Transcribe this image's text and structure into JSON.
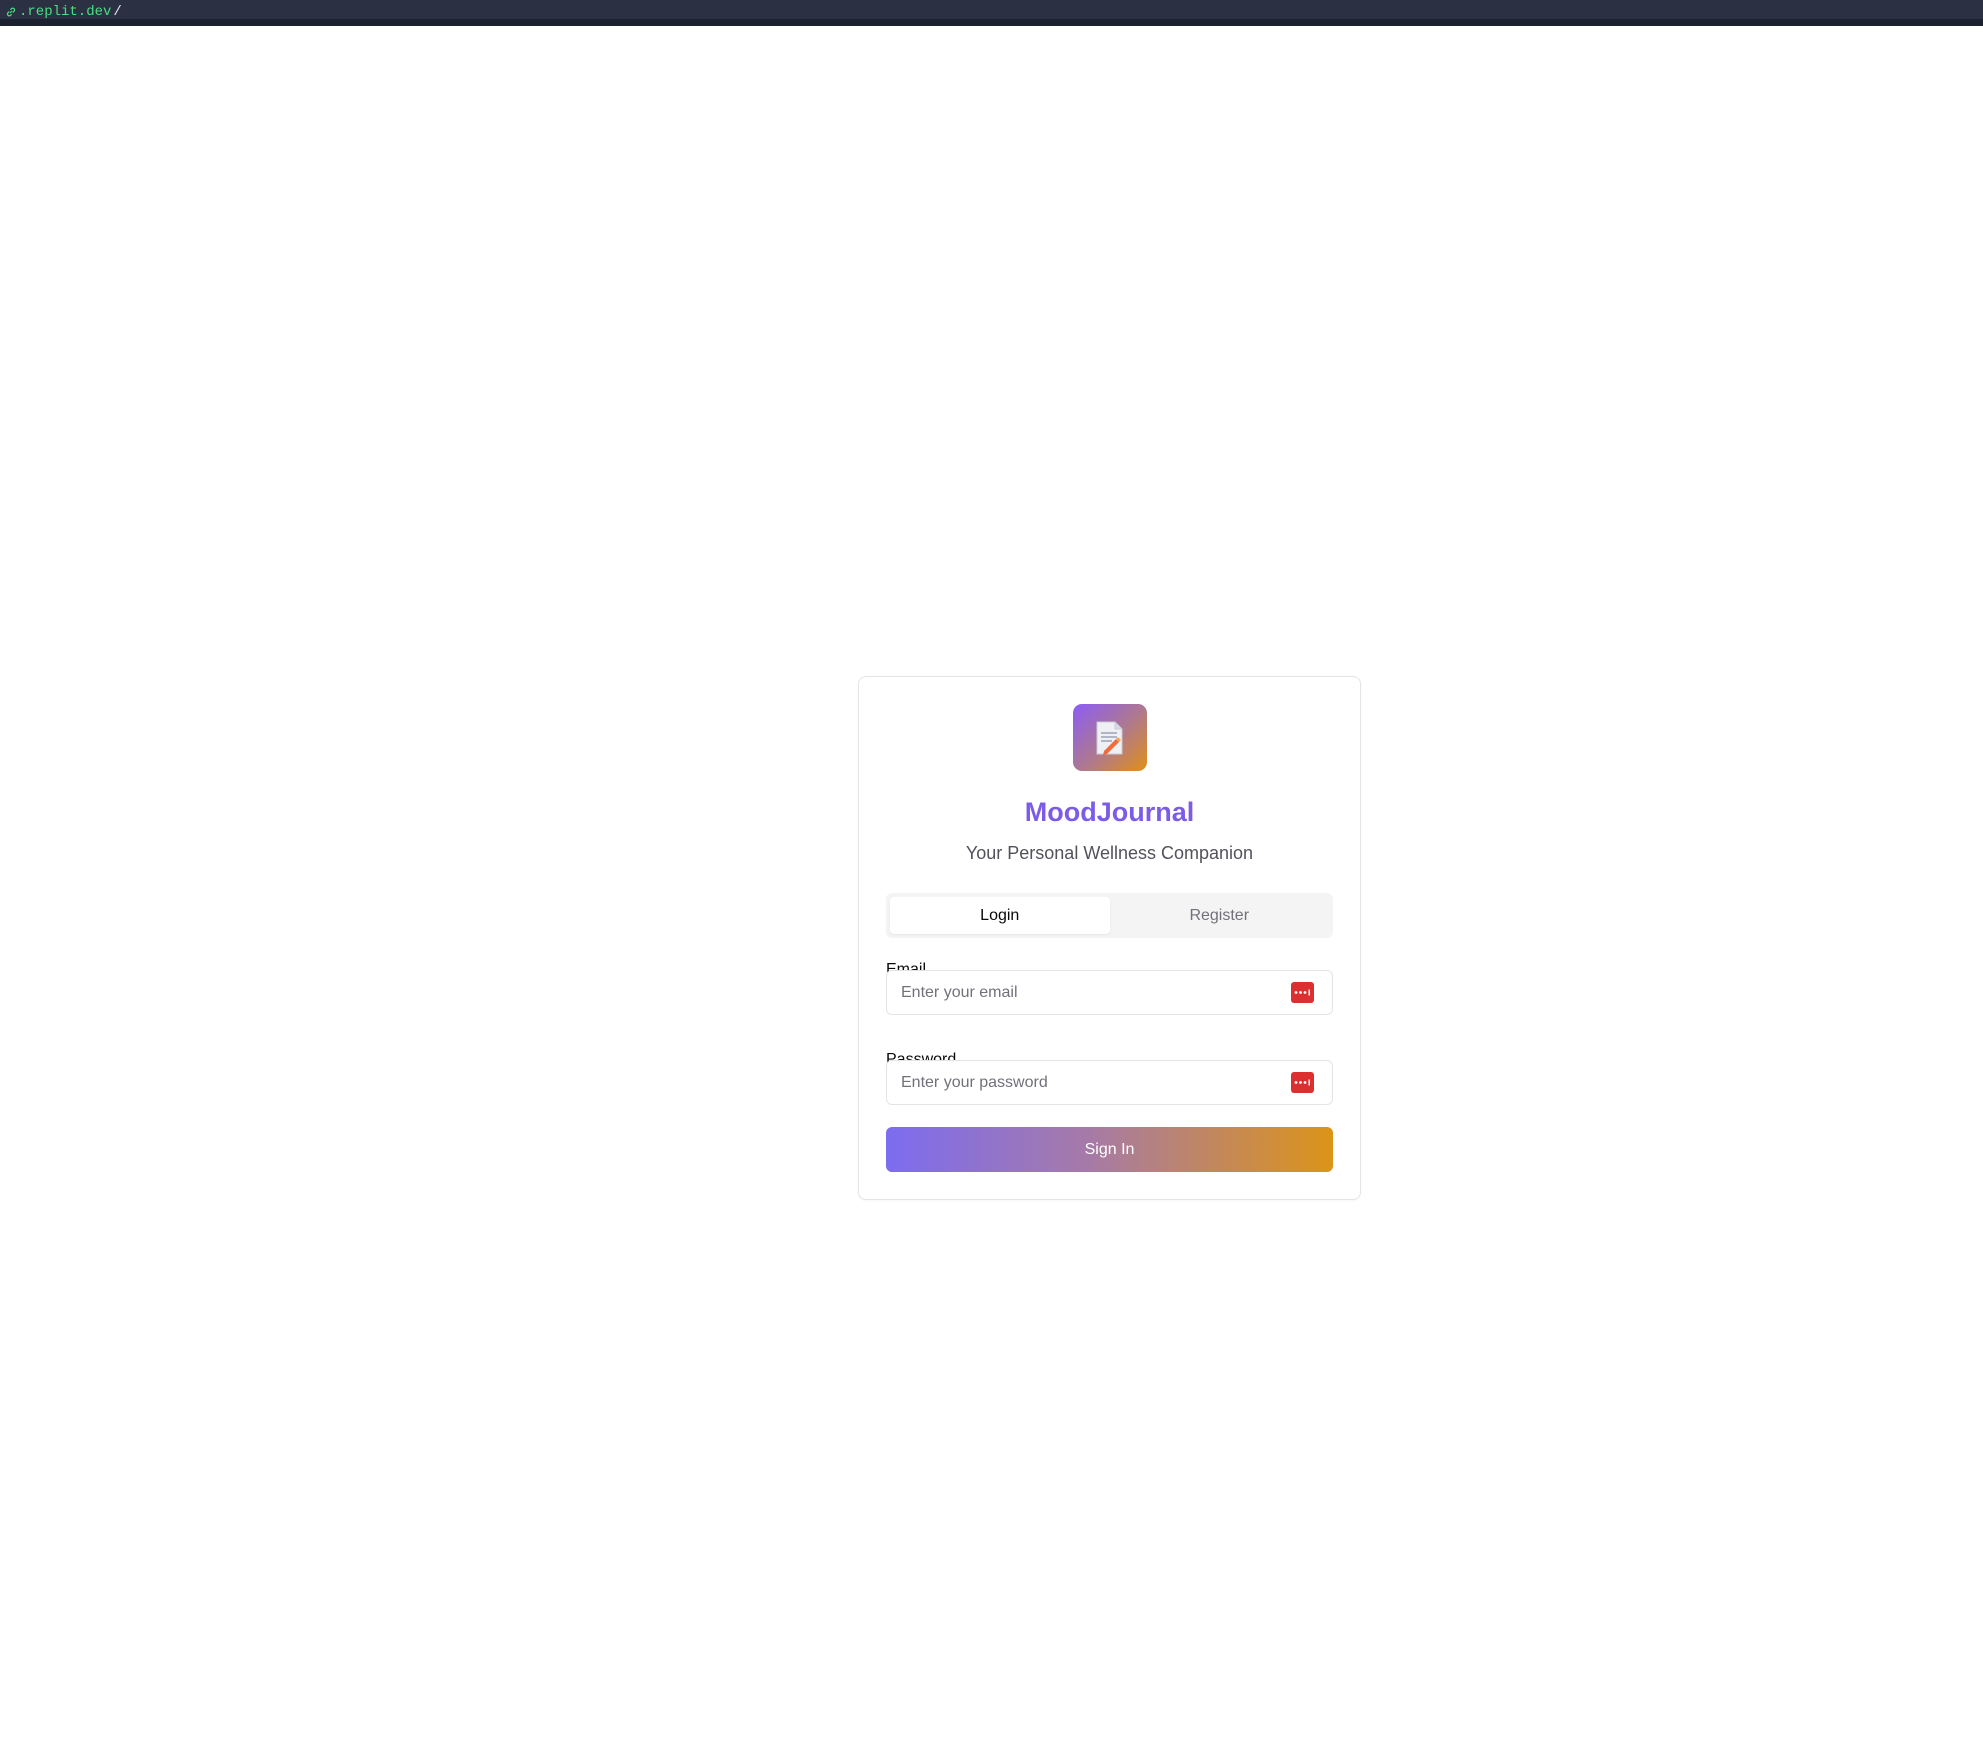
{
  "browser": {
    "url_host": ".replit.dev",
    "url_path": "/"
  },
  "app": {
    "title": "MoodJournal",
    "subtitle": "Your Personal Wellness Companion",
    "logo_icon": "memo-pencil-icon"
  },
  "tabs": [
    {
      "label": "Login",
      "active": true
    },
    {
      "label": "Register",
      "active": false
    }
  ],
  "form": {
    "email_label": "Email",
    "email_placeholder": "Enter your email",
    "email_value": "",
    "password_label": "Password",
    "password_placeholder": "Enter your password",
    "password_value": "",
    "field_icon": "password-manager-icon",
    "submit_label": "Sign In"
  },
  "colors": {
    "accent": "#7c5ce6",
    "gradient_start": "#7c6cf0",
    "gradient_end": "#dc9418",
    "password_manager_icon": "#dc2f2f"
  }
}
